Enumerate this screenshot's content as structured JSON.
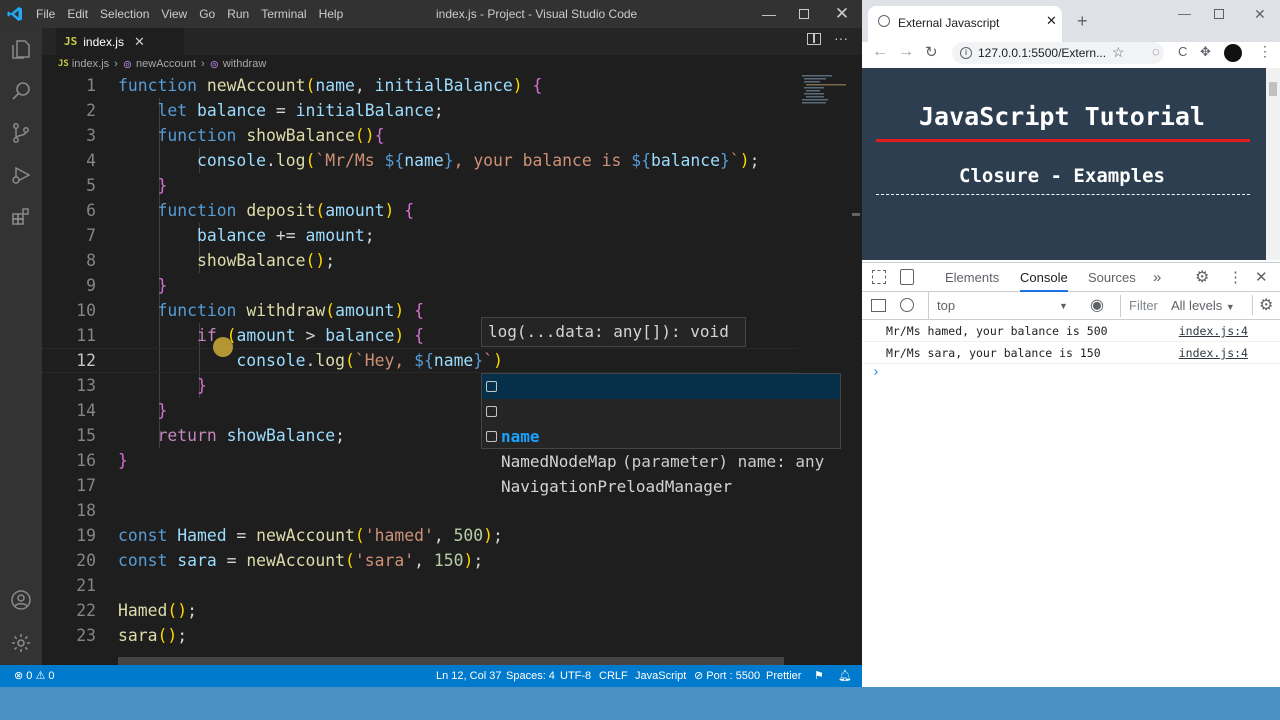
{
  "vscode": {
    "menu": [
      "File",
      "Edit",
      "Selection",
      "View",
      "Go",
      "Run",
      "Terminal",
      "Help"
    ],
    "window_title": "index.js - Project - Visual Studio Code",
    "tab": {
      "label": "index.js"
    },
    "breadcrumb": [
      "index.js",
      "newAccount",
      "withdraw"
    ],
    "editor": {
      "line_numbers": [
        "1",
        "2",
        "3",
        "4",
        "5",
        "6",
        "7",
        "8",
        "9",
        "10",
        "11",
        "12",
        "13",
        "14",
        "15",
        "16",
        "17",
        "18",
        "19",
        "20",
        "21",
        "22",
        "23"
      ],
      "active_line": "12",
      "lines": [
        "function newAccount(name, initialBalance) {",
        "    let balance = initialBalance;",
        "    function showBalance(){",
        "        console.log(`Mr/Ms ${name}, your balance is ${balance}`);",
        "    }",
        "    function deposit(amount) {",
        "        balance += amount;",
        "        showBalance();",
        "    }",
        "    function withdraw(amount) {",
        "        if (amount > balance) {",
        "            console.log(`Hey, ${name}`)",
        "        }",
        "    }",
        "    return showBalance;",
        "}",
        "",
        "",
        "const Hamed = newAccount('hamed', 500);",
        "const sara = newAccount('sara', 150);",
        "",
        "Hamed();",
        "sara();"
      ]
    },
    "parameter_hint": "log(...data: any[]): void",
    "suggestions": [
      {
        "label": "name",
        "detail": "(parameter) name: any"
      },
      {
        "label": "NamedNodeMap",
        "detail": ""
      },
      {
        "label": "NavigationPreloadManager",
        "detail": ""
      }
    ],
    "status": {
      "problems": "0",
      "warnings": "0",
      "position": "Ln 12, Col 37",
      "spaces": "Spaces: 4",
      "encoding": "UTF-8",
      "eol": "CRLF",
      "language": "JavaScript",
      "port": "Port : 5500",
      "formatter": "Prettier"
    }
  },
  "browser": {
    "tab_title": "External Javascript",
    "url": "127.0.0.1:5500/Extern...",
    "page": {
      "title": "JavaScript Tutorial",
      "subtitle": "Closure - Examples"
    },
    "devtools": {
      "tabs": [
        "Elements",
        "Console",
        "Sources"
      ],
      "context": "top",
      "filter_placeholder": "Filter",
      "levels": "All levels",
      "messages": [
        {
          "text": "Mr/Ms hamed, your balance is 500",
          "source": "index.js:4"
        },
        {
          "text": "Mr/Ms sara, your balance is 150",
          "source": "index.js:4"
        }
      ]
    }
  },
  "colors": {
    "statusbar": "#007acc",
    "accent": "#18a3ff",
    "page_bg": "#2c3e50",
    "rule": "#e01e1e"
  }
}
